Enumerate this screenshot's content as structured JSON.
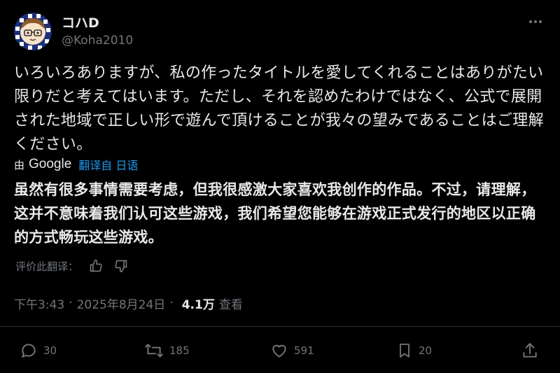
{
  "author": {
    "display_name": "コハD",
    "handle": "@Koha2010"
  },
  "tweet": {
    "text": "いろいろありますが、私の作ったタイトルを愛してくれることはありがたい限りだと考えてはいます。ただし、それを認めたわけではなく、公式で展開された地域で正しい形で遊んで頂けることが我々の望みであることはご理解ください。"
  },
  "translation": {
    "by_label": "由",
    "provider": "Google",
    "translated_from": "翻译自 日语",
    "text": "虽然有很多事情需要考虑，但我很感激大家喜欢我创作的作品。不过，请理解，这并不意味着我们认可这些游戏，我们希望您能够在游戏正式发行的地区以正确的方式畅玩这些游戏。",
    "rate_prompt": "评价此翻译："
  },
  "meta": {
    "time": "下午3:43",
    "separator": "·",
    "date": "2025年8月24日",
    "views_count": "4.1万",
    "views_label": "查看"
  },
  "actions": {
    "replies": "30",
    "reposts": "185",
    "likes": "591",
    "bookmarks": "20"
  },
  "icons": [
    "more-icon",
    "thumbs-up-icon",
    "thumbs-down-icon",
    "reply-icon",
    "repost-icon",
    "like-icon",
    "bookmark-icon",
    "share-icon"
  ],
  "colors": {
    "background": "#000000",
    "text": "#e7e9ea",
    "muted": "#71767b",
    "link": "#1d9bf0"
  }
}
